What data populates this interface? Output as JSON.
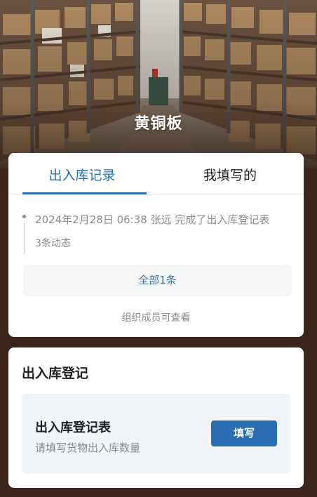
{
  "header": {
    "title": "黄铜板"
  },
  "tabs": [
    {
      "label": "出入库记录",
      "active": true
    },
    {
      "label": "我填写的",
      "active": false
    }
  ],
  "activity": {
    "entry_text": "2024年2月28日 06:38  张远  完成了出入库登记表",
    "count_text": "3条动态"
  },
  "all_button": {
    "label": "全部1条"
  },
  "visibility_note": "组织成员可查看",
  "registration": {
    "section_title": "出入库登记",
    "form_title": "出入库登记表",
    "form_subtitle": "请填写货物出入库数量",
    "fill_button": "填写"
  },
  "colors": {
    "accent": "#2a6fb1",
    "button": "#2b6db2",
    "background": "#3b2418",
    "form_box": "#f0f4f8"
  }
}
